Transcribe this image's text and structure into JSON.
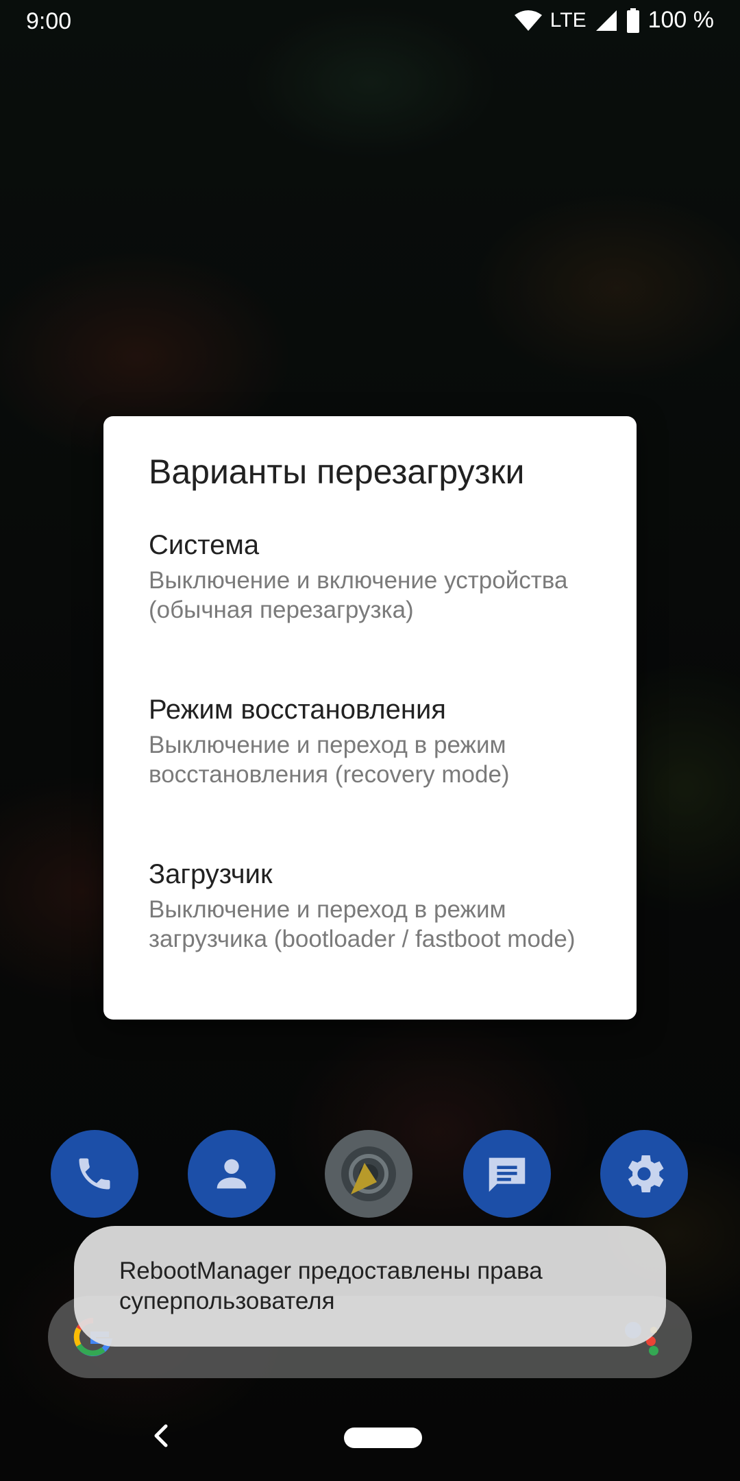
{
  "status_bar": {
    "time": "9:00",
    "network": "LTE",
    "battery": "100 %",
    "icons": [
      "wifi-icon",
      "signal-icon",
      "battery-icon"
    ]
  },
  "dialog": {
    "title": "Варианты перезагрузки",
    "options": [
      {
        "title": "Система",
        "description": "Выключение и включение устройства (обычная перезагрузка)"
      },
      {
        "title": "Режим восстановления",
        "description": "Выключение и переход в режим восстановления (recovery mode)"
      },
      {
        "title": "Загрузчик",
        "description": "Выключение и переход в режим загрузчика (bootloader / fastboot mode)"
      }
    ]
  },
  "dock": {
    "apps": [
      "phone-icon",
      "contacts-icon",
      "camera-icon",
      "messages-icon",
      "settings-icon"
    ]
  },
  "search_bar": {
    "icons": [
      "google-logo-icon",
      "assistant-icon"
    ]
  },
  "toast": {
    "text": "RebootManager предоставлены права суперпользователя"
  },
  "nav": {
    "icons": [
      "back-icon",
      "home-pill"
    ]
  },
  "colors": {
    "dialog_bg": "#ffffff",
    "title_text": "#212121",
    "secondary_text": "#7a7a7a",
    "dock_blue": "#1c4fa8",
    "toast_bg": "#e1e1e1"
  }
}
